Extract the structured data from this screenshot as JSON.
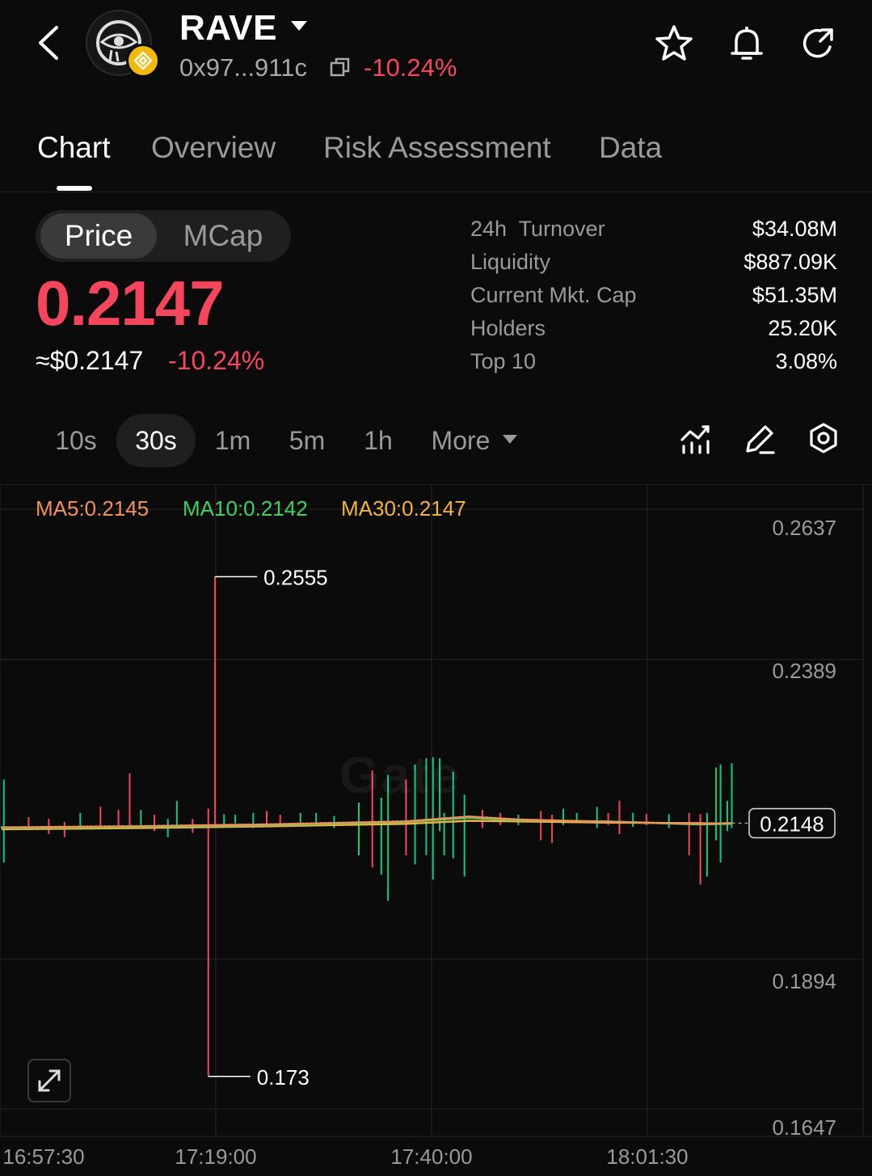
{
  "header": {
    "token_name": "RAVE",
    "address": "0x97...911c",
    "change": "-10.24%",
    "icons": [
      "back-arrow-icon",
      "star-icon",
      "bell-icon",
      "share-refresh-icon",
      "copy-icon",
      "eye-logo-icon",
      "bnb-chain-icon"
    ]
  },
  "tabs": [
    {
      "label": "Chart",
      "active": true
    },
    {
      "label": "Overview",
      "active": false
    },
    {
      "label": "Risk Assessment",
      "active": false
    },
    {
      "label": "Data",
      "active": false
    }
  ],
  "price_toggle": {
    "options": [
      "Price",
      "MCap"
    ],
    "selected": "Price"
  },
  "price": {
    "value": "0.2147",
    "usd": "≈$0.2147",
    "change": "-10.24%"
  },
  "stats": [
    {
      "label": "24h  Turnover",
      "value": "$34.08M"
    },
    {
      "label": "Liquidity",
      "value": "$887.09K"
    },
    {
      "label": "Current Mkt. Cap",
      "value": "$51.35M"
    },
    {
      "label": "Holders",
      "value": "25.20K"
    },
    {
      "label": "Top 10",
      "value": "3.08%"
    }
  ],
  "intervals": {
    "options": [
      "10s",
      "30s",
      "1m",
      "5m",
      "1h",
      "More"
    ],
    "selected": "30s"
  },
  "colors": {
    "up": "#0ecb81",
    "down": "#f6465d",
    "ma5": "#f0915a",
    "ma10": "#3fcf62",
    "ma30": "#f0b43c",
    "background": "#0b0b0b"
  },
  "chart_data": {
    "type": "candlestick",
    "indicators": [
      {
        "name": "MA5",
        "label": "MA5:0.2145",
        "value": 0.2145
      },
      {
        "name": "MA10",
        "label": "MA10:0.2142",
        "value": 0.2142
      },
      {
        "name": "MA30",
        "label": "MA30:0.2147",
        "value": 0.2147
      }
    ],
    "y_ticks": [
      "0.2637",
      "0.2389",
      "0.1894",
      "0.1647"
    ],
    "y_tick_values": [
      0.2637,
      0.2389,
      0.1894,
      0.1647
    ],
    "x_ticks": [
      "16:57:30",
      "17:19:00",
      "17:40:00",
      "18:01:30"
    ],
    "high_marker": {
      "label": "0.2555",
      "value": 0.2555
    },
    "low_marker": {
      "label": "0.173",
      "value": 0.173
    },
    "last_price": {
      "label": "0.2148",
      "value": 0.2148
    },
    "watermark": "Gate",
    "wicks": [
      {
        "i": 1,
        "low": 0.2083,
        "high": 0.222,
        "dir": "up"
      },
      {
        "i": 12,
        "low": 0.2142,
        "high": 0.2158,
        "dir": "down"
      },
      {
        "i": 21,
        "low": 0.213,
        "high": 0.2155,
        "dir": "down"
      },
      {
        "i": 28,
        "low": 0.2125,
        "high": 0.215,
        "dir": "down"
      },
      {
        "i": 35,
        "low": 0.214,
        "high": 0.2165,
        "dir": "up"
      },
      {
        "i": 44,
        "low": 0.2138,
        "high": 0.2175,
        "dir": "down"
      },
      {
        "i": 52,
        "low": 0.2142,
        "high": 0.217,
        "dir": "down"
      },
      {
        "i": 57,
        "low": 0.214,
        "high": 0.223,
        "dir": "down"
      },
      {
        "i": 62,
        "low": 0.214,
        "high": 0.217,
        "dir": "up"
      },
      {
        "i": 68,
        "low": 0.2135,
        "high": 0.2162,
        "dir": "down"
      },
      {
        "i": 74,
        "low": 0.2125,
        "high": 0.2155,
        "dir": "up"
      },
      {
        "i": 78,
        "low": 0.2143,
        "high": 0.2185,
        "dir": "up"
      },
      {
        "i": 85,
        "low": 0.2132,
        "high": 0.2155,
        "dir": "down"
      },
      {
        "i": 92,
        "low": 0.173,
        "high": 0.2172,
        "dir": "down"
      },
      {
        "i": 95,
        "low": 0.214,
        "high": 0.2555,
        "dir": "down"
      },
      {
        "i": 99,
        "low": 0.2145,
        "high": 0.2163,
        "dir": "up"
      },
      {
        "i": 104,
        "low": 0.2148,
        "high": 0.2162,
        "dir": "up"
      },
      {
        "i": 112,
        "low": 0.214,
        "high": 0.2165,
        "dir": "up"
      },
      {
        "i": 118,
        "low": 0.2145,
        "high": 0.2168,
        "dir": "down"
      },
      {
        "i": 124,
        "low": 0.2145,
        "high": 0.2162,
        "dir": "down"
      },
      {
        "i": 133,
        "low": 0.2145,
        "high": 0.2165,
        "dir": "up"
      },
      {
        "i": 140,
        "low": 0.2143,
        "high": 0.2165,
        "dir": "up"
      },
      {
        "i": 148,
        "low": 0.214,
        "high": 0.216,
        "dir": "up"
      },
      {
        "i": 159,
        "low": 0.2095,
        "high": 0.2182,
        "dir": "up"
      },
      {
        "i": 165,
        "low": 0.2075,
        "high": 0.2235,
        "dir": "down"
      },
      {
        "i": 169,
        "low": 0.2063,
        "high": 0.219,
        "dir": "up"
      },
      {
        "i": 172,
        "low": 0.202,
        "high": 0.2228,
        "dir": "up"
      },
      {
        "i": 180,
        "low": 0.2095,
        "high": 0.222,
        "dir": "down"
      },
      {
        "i": 184,
        "low": 0.208,
        "high": 0.2245,
        "dir": "up"
      },
      {
        "i": 189,
        "low": 0.2095,
        "high": 0.2255,
        "dir": "up"
      },
      {
        "i": 192,
        "low": 0.2055,
        "high": 0.2257,
        "dir": "up"
      },
      {
        "i": 195,
        "low": 0.2135,
        "high": 0.2255,
        "dir": "up"
      },
      {
        "i": 197,
        "low": 0.2095,
        "high": 0.2165,
        "dir": "up"
      },
      {
        "i": 201,
        "low": 0.209,
        "high": 0.2233,
        "dir": "up"
      },
      {
        "i": 206,
        "low": 0.206,
        "high": 0.2195,
        "dir": "up"
      },
      {
        "i": 214,
        "low": 0.214,
        "high": 0.217,
        "dir": "down"
      },
      {
        "i": 222,
        "low": 0.2145,
        "high": 0.2165,
        "dir": "down"
      },
      {
        "i": 230,
        "low": 0.2145,
        "high": 0.2162,
        "dir": "up"
      },
      {
        "i": 240,
        "low": 0.212,
        "high": 0.2168,
        "dir": "down"
      },
      {
        "i": 245,
        "low": 0.2115,
        "high": 0.2162,
        "dir": "down"
      },
      {
        "i": 250,
        "low": 0.2145,
        "high": 0.2172,
        "dir": "up"
      },
      {
        "i": 256,
        "low": 0.2148,
        "high": 0.2165,
        "dir": "up"
      },
      {
        "i": 265,
        "low": 0.214,
        "high": 0.2175,
        "dir": "up"
      },
      {
        "i": 270,
        "low": 0.2145,
        "high": 0.2165,
        "dir": "down"
      },
      {
        "i": 275,
        "low": 0.213,
        "high": 0.2185,
        "dir": "down"
      },
      {
        "i": 281,
        "low": 0.2142,
        "high": 0.2165,
        "dir": "up"
      },
      {
        "i": 287,
        "low": 0.2145,
        "high": 0.2163,
        "dir": "down"
      },
      {
        "i": 297,
        "low": 0.214,
        "high": 0.2163,
        "dir": "up"
      },
      {
        "i": 306,
        "low": 0.2095,
        "high": 0.2165,
        "dir": "down"
      },
      {
        "i": 311,
        "low": 0.2047,
        "high": 0.2163,
        "dir": "down"
      },
      {
        "i": 314,
        "low": 0.206,
        "high": 0.2165,
        "dir": "up"
      },
      {
        "i": 318,
        "low": 0.212,
        "high": 0.224,
        "dir": "up"
      },
      {
        "i": 320,
        "low": 0.2083,
        "high": 0.2245,
        "dir": "up"
      },
      {
        "i": 323,
        "low": 0.2135,
        "high": 0.2185,
        "dir": "up"
      },
      {
        "i": 325,
        "low": 0.214,
        "high": 0.2247,
        "dir": "up"
      }
    ],
    "ma_lines": {
      "MA5": [
        [
          0,
          0.2141
        ],
        [
          60,
          0.2143
        ],
        [
          120,
          0.2146
        ],
        [
          180,
          0.2151
        ],
        [
          208,
          0.2159
        ],
        [
          230,
          0.2154
        ],
        [
          270,
          0.215
        ],
        [
          310,
          0.2147
        ],
        [
          325,
          0.2148
        ]
      ],
      "MA10": [
        [
          0,
          0.214
        ],
        [
          60,
          0.2142
        ],
        [
          120,
          0.2145
        ],
        [
          180,
          0.215
        ],
        [
          208,
          0.2157
        ],
        [
          230,
          0.2153
        ],
        [
          270,
          0.2151
        ],
        [
          310,
          0.2146
        ],
        [
          325,
          0.2147
        ]
      ],
      "MA30": [
        [
          0,
          0.2138
        ],
        [
          60,
          0.214
        ],
        [
          120,
          0.2143
        ],
        [
          180,
          0.2147
        ],
        [
          208,
          0.2152
        ],
        [
          230,
          0.2151
        ],
        [
          270,
          0.2149
        ],
        [
          310,
          0.2148
        ],
        [
          325,
          0.2147
        ]
      ]
    }
  }
}
